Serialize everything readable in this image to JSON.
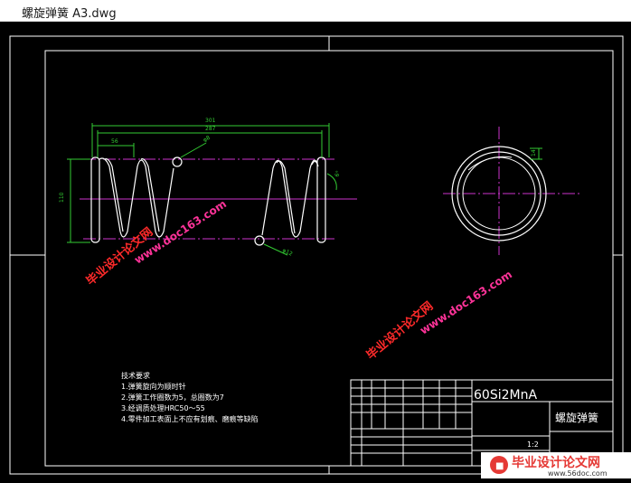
{
  "window": {
    "title": "螺旋弹簧 A3.dwg"
  },
  "colors": {
    "background": "#000000",
    "frame": "#ffffff",
    "dimension": "#33cc33",
    "centerline": "#cc33cc",
    "watermark": "#ff2a2a",
    "watermark_url": "#ff3399"
  },
  "dims": {
    "overall": "301",
    "inner": "287",
    "pitch": "56",
    "height": "110",
    "wire_top": "φ8",
    "wire_bottom": "φ12",
    "angle": "6°",
    "ring_top": "14"
  },
  "tech": {
    "heading": "技术要求",
    "items": [
      "1.弹簧旋向为顺时针",
      "2.弹簧工作圈数为5，总圈数为7",
      "3.经调质处理HRC50～55",
      "4.零件加工表面上不应有划痕、磨痕等缺陷"
    ]
  },
  "titleblock": {
    "material": "60Si2MnA",
    "part_name": "螺旋弹簧",
    "scale": "1:2"
  },
  "watermarks": {
    "site": "毕业设计论文网",
    "url": "www.doc163.com",
    "footer_site": "毕业设计论文网",
    "footer_url": "www.56doc.com"
  }
}
